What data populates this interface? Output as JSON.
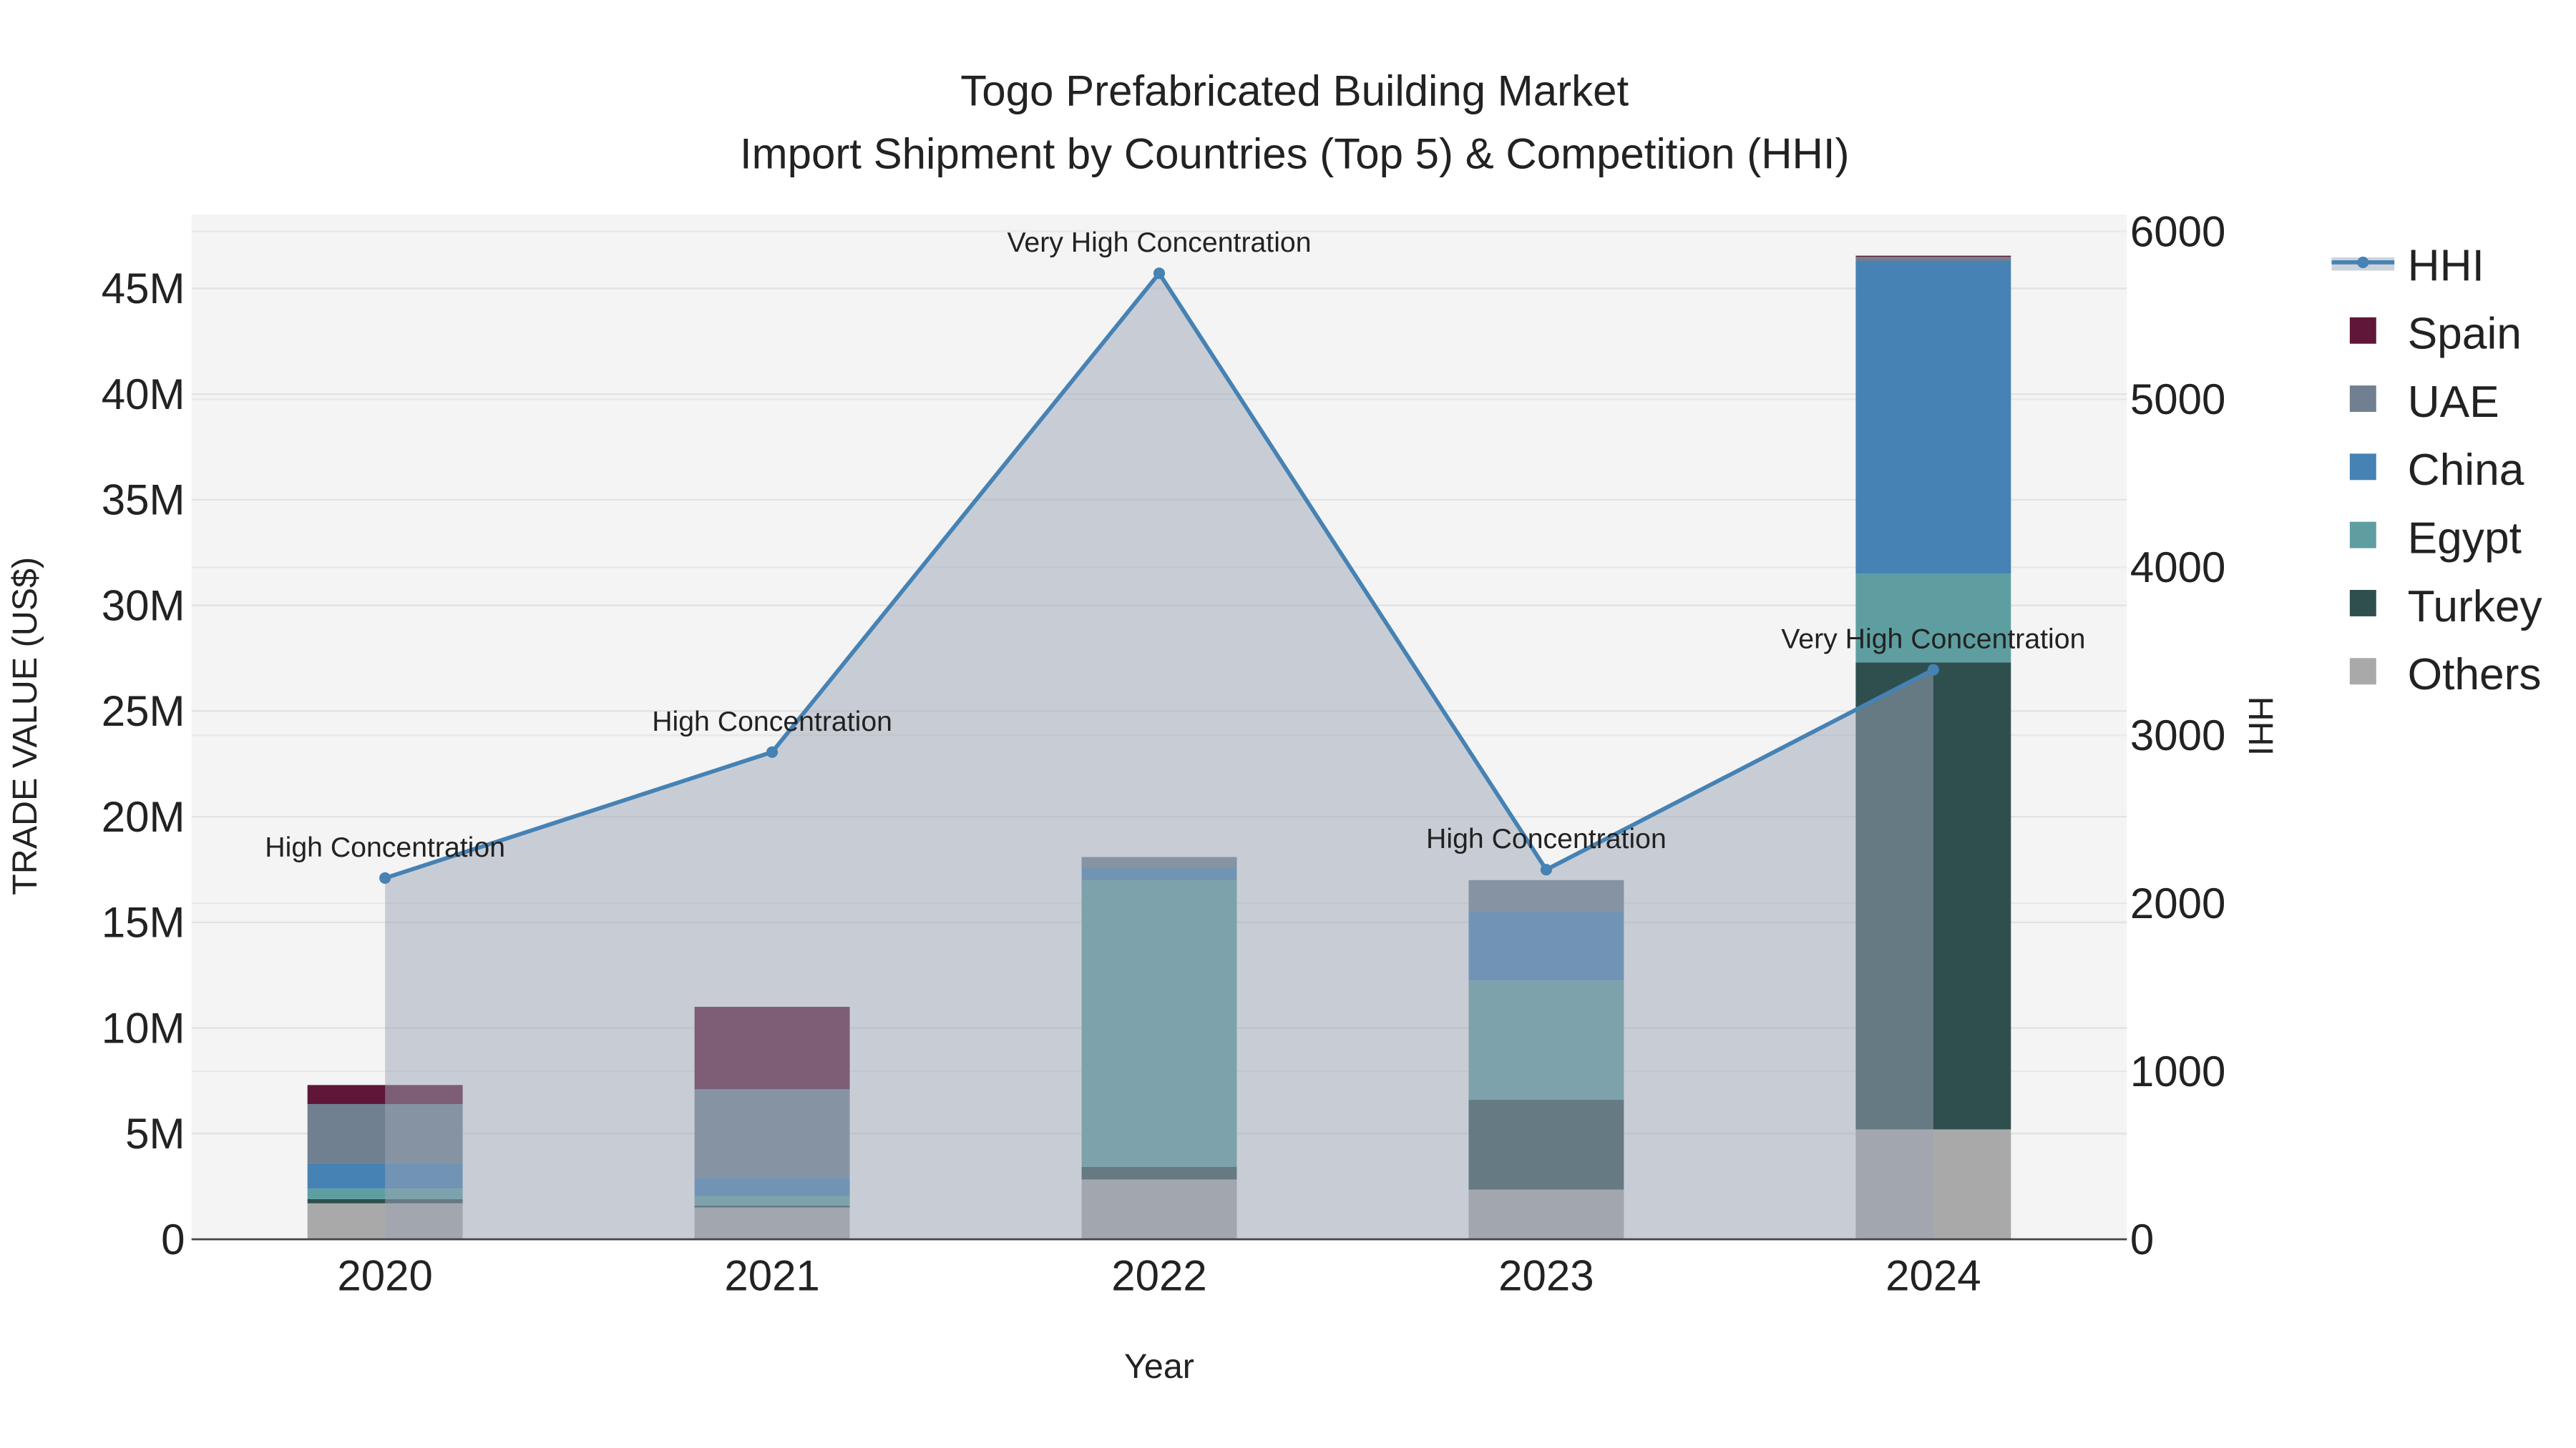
{
  "chart_data": {
    "type": "bar",
    "stacked": true,
    "title": "Togo Prefabricated Building Market",
    "subtitle": "Import Shipment by Countries (Top 5) & Competition (HHI)",
    "xlabel": "Year",
    "ylabel": "TRADE VALUE (US$)",
    "y2label": "HHI",
    "categories": [
      "2020",
      "2021",
      "2022",
      "2023",
      "2024"
    ],
    "ylim": [
      0,
      48500000
    ],
    "y_ticks": [
      0,
      5000000,
      10000000,
      15000000,
      20000000,
      25000000,
      30000000,
      35000000,
      40000000,
      45000000
    ],
    "y_tick_labels": [
      "0",
      "5M",
      "10M",
      "15M",
      "20M",
      "25M",
      "30M",
      "35M",
      "40M",
      "45M"
    ],
    "y2lim": [
      0,
      6100
    ],
    "y2_ticks": [
      0,
      1000,
      2000,
      3000,
      4000,
      5000,
      6000
    ],
    "y2_tick_labels": [
      "0",
      "1000",
      "2000",
      "3000",
      "4000",
      "5000",
      "6000"
    ],
    "series": [
      {
        "name": "Others",
        "color": "#a9a9a9",
        "values": [
          1700000,
          1500000,
          2830000,
          2350000,
          5200000
        ]
      },
      {
        "name": "Turkey",
        "color": "#2f4f4f",
        "values": [
          200000,
          100000,
          600000,
          4250000,
          22100000
        ]
      },
      {
        "name": "Egypt",
        "color": "#5f9ea0",
        "values": [
          500000,
          450000,
          13560000,
          5650000,
          4200000
        ]
      },
      {
        "name": "China",
        "color": "#4682b4",
        "values": [
          1200000,
          850000,
          560000,
          3250000,
          14800000
        ]
      },
      {
        "name": "UAE",
        "color": "#708090",
        "values": [
          2800000,
          4200000,
          540000,
          1500000,
          200000
        ]
      },
      {
        "name": "Spain",
        "color": "#5f1637",
        "values": [
          900000,
          3900000,
          0,
          0,
          50000
        ]
      }
    ],
    "hhi": {
      "name": "HHI",
      "color": "#4682b4",
      "values": [
        2150,
        2900,
        5750,
        2200,
        3390
      ],
      "annotations": [
        "High Concentration",
        "High Concentration",
        "Very High Concentration",
        "High Concentration",
        "Very High Concentration"
      ]
    },
    "legend_order": [
      "HHI",
      "Spain",
      "UAE",
      "China",
      "Egypt",
      "Turkey",
      "Others"
    ],
    "legend_position": "right",
    "grid": true
  }
}
